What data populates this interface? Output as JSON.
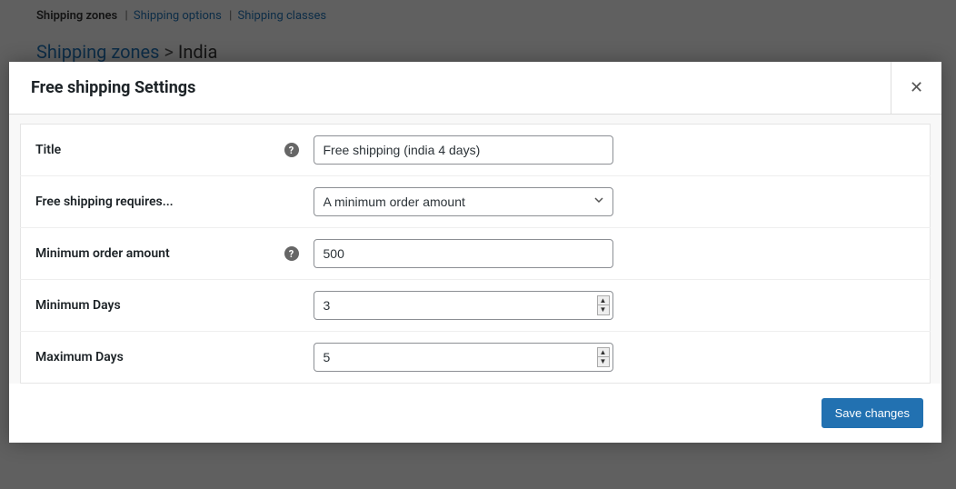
{
  "background": {
    "tabs": {
      "zones": "Shipping zones",
      "options": "Shipping options",
      "classes": "Shipping classes"
    },
    "breadcrumb": {
      "root": "Shipping zones",
      "sep": ">",
      "current": "India"
    }
  },
  "modal": {
    "title": "Free shipping Settings",
    "close": "✕",
    "fields": {
      "title": {
        "label": "Title",
        "value": "Free shipping (india 4 days)",
        "help": "?"
      },
      "requires": {
        "label": "Free shipping requires...",
        "value": "A minimum order amount"
      },
      "min_amount": {
        "label": "Minimum order amount",
        "value": "500",
        "help": "?"
      },
      "min_days": {
        "label": "Minimum Days",
        "value": "3"
      },
      "max_days": {
        "label": "Maximum Days",
        "value": "5"
      }
    },
    "save_label": "Save changes"
  }
}
